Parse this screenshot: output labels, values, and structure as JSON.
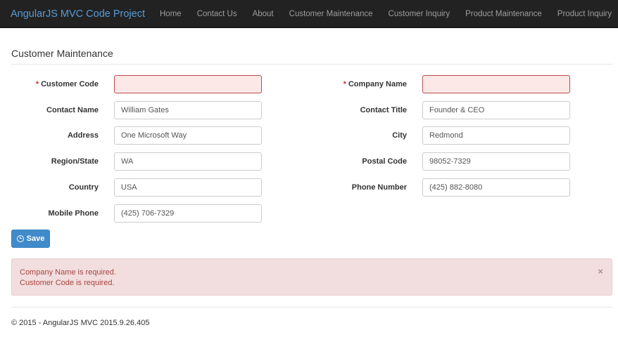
{
  "navbar": {
    "brand": "AngularJS MVC Code Project",
    "links": [
      "Home",
      "Contact Us",
      "About",
      "Customer Maintenance",
      "Customer Inquiry",
      "Product Maintenance",
      "Product Inquiry"
    ]
  },
  "page": {
    "title": "Customer Maintenance"
  },
  "form": {
    "customer_code": {
      "label": "Customer Code",
      "required_mark": "*",
      "value": ""
    },
    "company_name": {
      "label": "Company Name",
      "required_mark": "*",
      "value": ""
    },
    "contact_name": {
      "label": "Contact Name",
      "value": "William Gates"
    },
    "contact_title": {
      "label": "Contact Title",
      "value": "Founder & CEO"
    },
    "address": {
      "label": "Address",
      "value": "One Microsoft Way"
    },
    "city": {
      "label": "City",
      "value": "Redmond"
    },
    "region_state": {
      "label": "Region/State",
      "value": "WA"
    },
    "postal_code": {
      "label": "Postal Code",
      "value": "98052-7329"
    },
    "country": {
      "label": "Country",
      "value": "USA"
    },
    "phone_number": {
      "label": "Phone Number",
      "value": "(425) 882-8080"
    },
    "mobile_phone": {
      "label": "Mobile Phone",
      "value": "(425) 706-7329"
    }
  },
  "save_button": {
    "label": "Save",
    "icon": "clock-icon"
  },
  "alert": {
    "messages": [
      "Company Name is required.",
      "Customer Code is required."
    ],
    "close_symbol": "×"
  },
  "footer": {
    "text": "© 2015 - AngularJS MVC 2015.9.26.405"
  },
  "colors": {
    "navbar_bg": "#222222",
    "brand": "#5a9bd5",
    "primary_button": "#428bca",
    "alert_bg": "#f2dede",
    "alert_text": "#a94442",
    "error_border": "#b94a48",
    "error_fill": "#fde8e8"
  }
}
